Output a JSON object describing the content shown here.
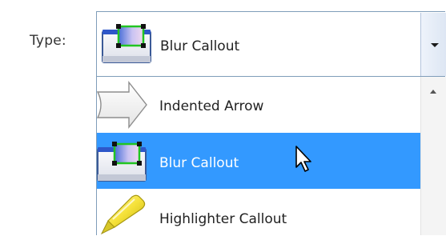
{
  "form": {
    "type_label": "Type:"
  },
  "combo": {
    "selected_label": "Blur Callout",
    "selected_icon": "blur-callout-icon"
  },
  "dropdown": {
    "items": [
      {
        "label": "Indented Arrow",
        "icon": "indented-arrow-icon"
      },
      {
        "label": "Blur Callout",
        "icon": "blur-callout-icon",
        "selected": true
      },
      {
        "label": "Highlighter Callout",
        "icon": "highlighter-icon"
      }
    ]
  },
  "colors": {
    "selection": "#3399ff",
    "border": "#7f9db9",
    "handle_green": "#22c522"
  }
}
